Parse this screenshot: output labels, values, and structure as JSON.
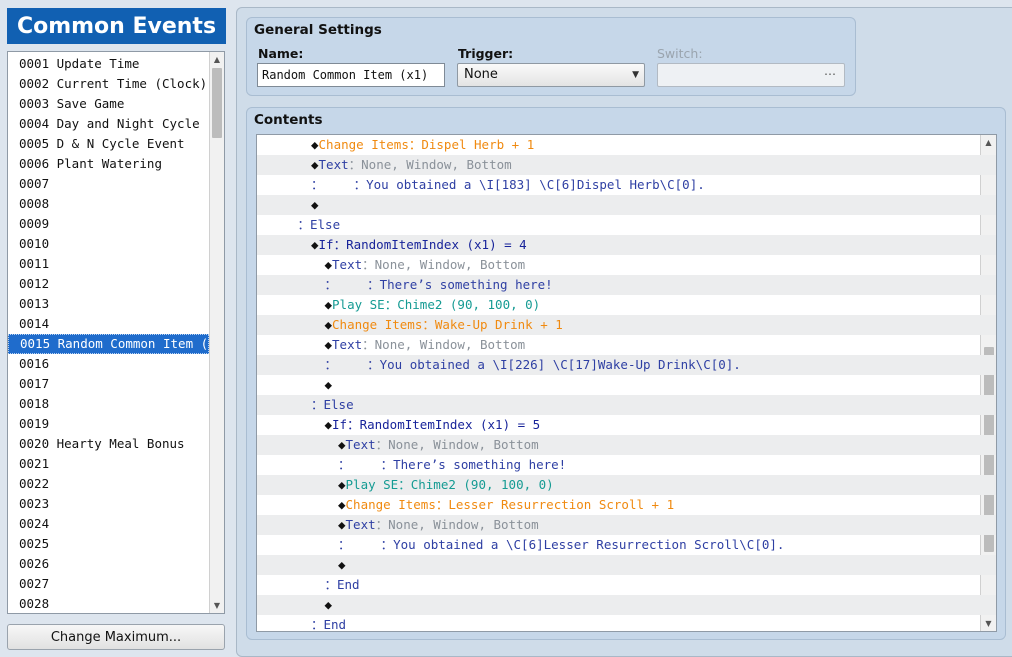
{
  "sidebar": {
    "title": "Common Events",
    "items": [
      "0001 Update Time",
      "0002 Current Time (Clock)",
      "0003 Save Game",
      "0004 Day and Night Cycle",
      "0005 D & N Cycle Event",
      "0006 Plant Watering",
      "0007",
      "0008",
      "0009",
      "0010",
      "0011",
      "0012",
      "0013",
      "0014",
      "0015 Random Common Item (⋯",
      "0016",
      "0017",
      "0018",
      "0019",
      "0020 Hearty Meal Bonus",
      "0021",
      "0022",
      "0023",
      "0024",
      "0025",
      "0026",
      "0027",
      "0028"
    ],
    "selected_index": 14,
    "change_max_label": "Change Maximum..."
  },
  "general": {
    "title": "General Settings",
    "name_label": "Name:",
    "name_value": "Random Common Item (x1)",
    "trigger_label": "Trigger:",
    "trigger_value": "None",
    "switch_label": "Switch:",
    "switch_button": "⋯"
  },
  "contents": {
    "title": "Contents",
    "lines": [
      {
        "indent": 4,
        "parts": [
          [
            "dia",
            "◆"
          ],
          [
            "orange",
            "Change Items：Dispel Herb + 1"
          ]
        ]
      },
      {
        "indent": 4,
        "parts": [
          [
            "dia",
            "◆"
          ],
          [
            "blue",
            "Text"
          ],
          [
            "gray",
            "：None, Window, Bottom"
          ]
        ]
      },
      {
        "indent": 4,
        "parts": [
          [
            "blue",
            "：    ：You obtained a \\I[183] \\C[6]Dispel Herb\\C[0]."
          ]
        ]
      },
      {
        "indent": 4,
        "parts": [
          [
            "dia",
            "◆"
          ]
        ]
      },
      {
        "indent": 3,
        "parts": [
          [
            "blue",
            "：Else"
          ]
        ]
      },
      {
        "indent": 4,
        "parts": [
          [
            "dia",
            "◆"
          ],
          [
            "navy",
            "If：RandomItemIndex (x1) = 4"
          ]
        ]
      },
      {
        "indent": 5,
        "parts": [
          [
            "dia",
            "◆"
          ],
          [
            "blue",
            "Text"
          ],
          [
            "gray",
            "：None, Window, Bottom"
          ]
        ]
      },
      {
        "indent": 5,
        "parts": [
          [
            "blue",
            "：    ：There’s something here!"
          ]
        ]
      },
      {
        "indent": 5,
        "parts": [
          [
            "dia",
            "◆"
          ],
          [
            "teal",
            "Play SE：Chime2 (90, 100, 0)"
          ]
        ]
      },
      {
        "indent": 5,
        "parts": [
          [
            "dia",
            "◆"
          ],
          [
            "orange",
            "Change Items：Wake-Up Drink + 1"
          ]
        ]
      },
      {
        "indent": 5,
        "parts": [
          [
            "dia",
            "◆"
          ],
          [
            "blue",
            "Text"
          ],
          [
            "gray",
            "：None, Window, Bottom"
          ]
        ]
      },
      {
        "indent": 5,
        "parts": [
          [
            "blue",
            "：    ：You obtained a \\I[226] \\C[17]Wake-Up Drink\\C[0]."
          ]
        ]
      },
      {
        "indent": 5,
        "parts": [
          [
            "dia",
            "◆"
          ]
        ]
      },
      {
        "indent": 4,
        "parts": [
          [
            "blue",
            "：Else"
          ]
        ]
      },
      {
        "indent": 5,
        "parts": [
          [
            "dia",
            "◆"
          ],
          [
            "navy",
            "If：RandomItemIndex (x1) = 5"
          ]
        ]
      },
      {
        "indent": 6,
        "parts": [
          [
            "dia",
            "◆"
          ],
          [
            "blue",
            "Text"
          ],
          [
            "gray",
            "：None, Window, Bottom"
          ]
        ]
      },
      {
        "indent": 6,
        "parts": [
          [
            "blue",
            "：    ：There’s something here!"
          ]
        ]
      },
      {
        "indent": 6,
        "parts": [
          [
            "dia",
            "◆"
          ],
          [
            "teal",
            "Play SE：Chime2 (90, 100, 0)"
          ]
        ]
      },
      {
        "indent": 6,
        "parts": [
          [
            "dia",
            "◆"
          ],
          [
            "orange",
            "Change Items：Lesser Resurrection Scroll + 1"
          ]
        ]
      },
      {
        "indent": 6,
        "parts": [
          [
            "dia",
            "◆"
          ],
          [
            "blue",
            "Text"
          ],
          [
            "gray",
            "：None, Window, Bottom"
          ]
        ]
      },
      {
        "indent": 6,
        "parts": [
          [
            "blue",
            "：    ：You obtained a \\C[6]Lesser Resurrection Scroll\\C[0]."
          ]
        ]
      },
      {
        "indent": 6,
        "parts": [
          [
            "dia",
            "◆"
          ]
        ]
      },
      {
        "indent": 5,
        "parts": [
          [
            "blue",
            "：End"
          ]
        ]
      },
      {
        "indent": 5,
        "parts": [
          [
            "dia",
            "◆"
          ]
        ]
      },
      {
        "indent": 4,
        "parts": [
          [
            "blue",
            "：End"
          ]
        ]
      }
    ]
  },
  "colors": {
    "title_bar": "#1160b2",
    "selection": "#1f6ccc",
    "change_items": "#f08a10",
    "text_command": "#2e3fa3",
    "play_se": "#159b93",
    "text_params": "#8a9199",
    "conditional": "#18249a"
  }
}
